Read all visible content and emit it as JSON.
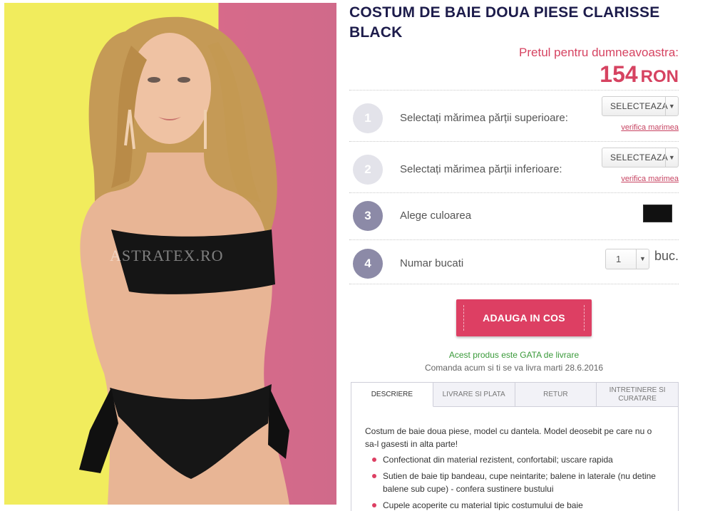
{
  "product": {
    "title": "COSTUM DE BAIE DOUA PIESE CLARISSE BLACK",
    "price_label": "Pretul pentru dumneavoastra:",
    "price_amount": "154",
    "price_currency": "RON",
    "image_watermark": "ASTRATEX.RO"
  },
  "options": [
    {
      "step": "1",
      "label": "Selectați mărimea părții superioare:",
      "select_value": "SELECTEAZA",
      "size_link": "verifica marimea"
    },
    {
      "step": "2",
      "label": "Selectați mărimea părții inferioare:",
      "select_value": "SELECTEAZA",
      "size_link": "verifica marimea"
    },
    {
      "step": "3",
      "label": "Alege culoarea",
      "swatch_color": "#111111"
    },
    {
      "step": "4",
      "label": "Numar bucati",
      "quantity": "1",
      "unit": "buc."
    }
  ],
  "cart": {
    "add_button": "ADAUGA IN COS",
    "stock_status": "Acest produs este GATA de livrare",
    "delivery_info": "Comanda acum si ti se va livra marti 28.6.2016"
  },
  "tabs": {
    "items": [
      "DESCRIERE",
      "LIVRARE SI PLATA",
      "RETUR",
      "INTRETINERE SI CURATARE"
    ],
    "active": "DESCRIERE",
    "description_intro": "Costum de baie doua piese, model cu dantela. Model deosebit pe care nu o sa-l gasesti in alta parte!",
    "bullets": [
      "Confectionat din material rezistent, confortabil; uscare rapida",
      "Sutien de baie tip bandeau, cupe neintarite; balene in laterale (nu detine balene sub cupe) - confera sustinere bustului",
      "Cupele acoperite cu material tipic costumului de baie"
    ]
  },
  "colors": {
    "brand_pink": "#dd3f63",
    "title_navy": "#1d1c4b",
    "in_stock_green": "#3a9a3a"
  },
  "icons": {
    "dropdown": "chevron-down-icon"
  }
}
